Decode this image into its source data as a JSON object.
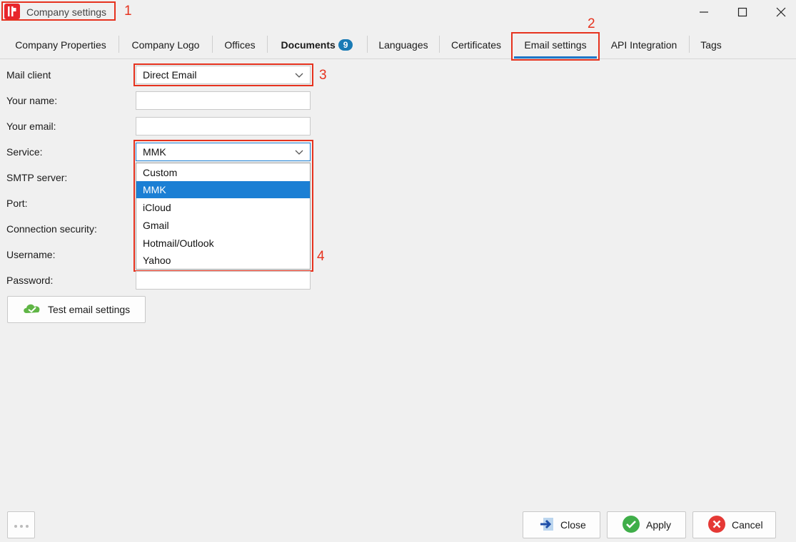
{
  "window": {
    "title": "Company settings",
    "controls": [
      "minimize-icon",
      "maximize-icon",
      "close-icon"
    ]
  },
  "annotations": [
    "1",
    "2",
    "3",
    "4"
  ],
  "tabs": [
    {
      "label": "Company Properties"
    },
    {
      "label": "Company Logo"
    },
    {
      "label": "Offices"
    },
    {
      "label": "Documents",
      "badge": "9"
    },
    {
      "label": "Languages"
    },
    {
      "label": "Certificates"
    },
    {
      "label": "Email settings",
      "active": true
    },
    {
      "label": "API Integration"
    },
    {
      "label": "Tags"
    }
  ],
  "form": {
    "mail_client_label": "Mail client",
    "mail_client_value": "Direct Email",
    "your_name_label": "Your name:",
    "your_name_value": "",
    "your_email_label": "Your email:",
    "your_email_value": "",
    "service_label": "Service:",
    "service_value": "MMK",
    "smtp_label": "SMTP server:",
    "port_label": "Port:",
    "security_label": "Connection security:",
    "username_label": "Username:",
    "password_label": "Password:",
    "password_value": ""
  },
  "service_options": [
    "Custom",
    "MMK",
    "iCloud",
    "Gmail",
    "Hotmail/Outlook",
    "Yahoo"
  ],
  "service_selected_index": 1,
  "buttons": {
    "test": "Test email settings",
    "close": "Close",
    "apply": "Apply",
    "cancel": "Cancel"
  },
  "colors": {
    "accent": "#1b7fd4",
    "annotation": "#e6321e",
    "badge": "#1a7bb5",
    "brand": "#e8262b"
  }
}
